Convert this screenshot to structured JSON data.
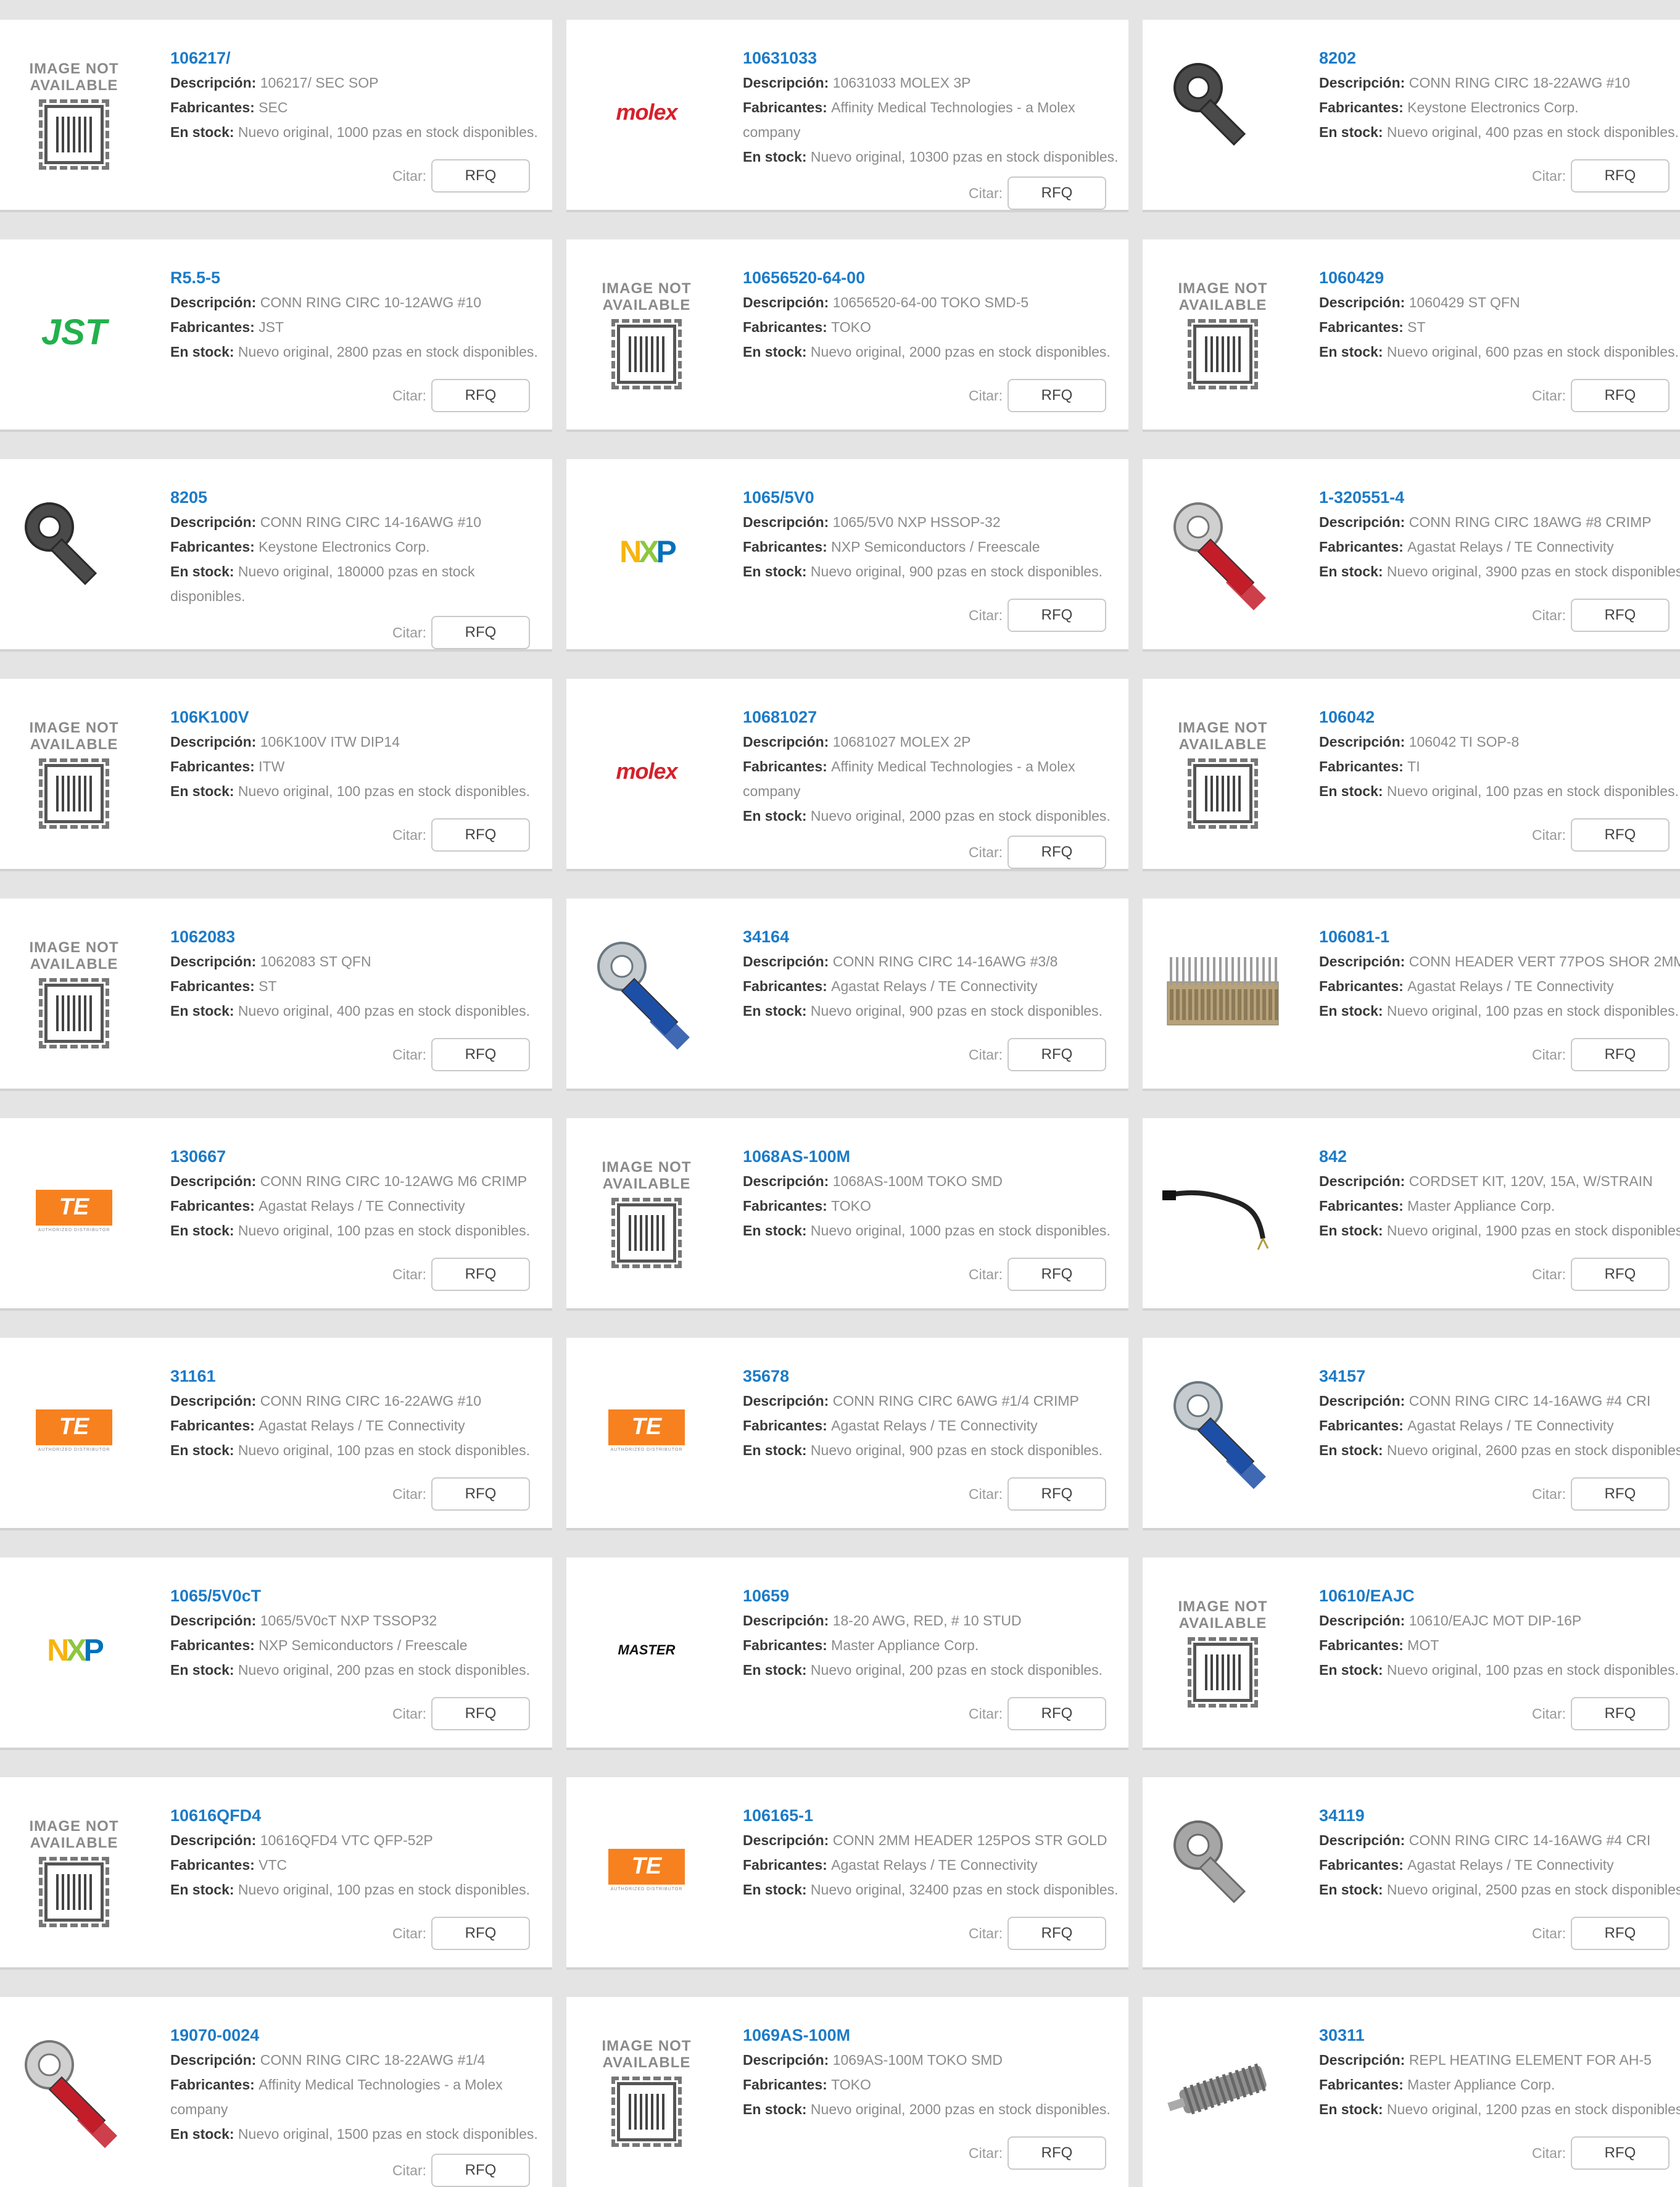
{
  "labels": {
    "desc": "Descripción:",
    "mfr": "Fabricantes:",
    "stock": "En stock:",
    "quote": "Citar:",
    "rfq": "RFQ"
  },
  "placeholder": {
    "line1": "IMAGE NOT",
    "line2": "AVAILABLE"
  },
  "logos": {
    "molex": "molex",
    "jst": "JST",
    "nxp": "NXP",
    "te": "TE",
    "te_sub": "AUTHORIZED DISTRIBUTOR",
    "master": "MASTER"
  },
  "colors": {
    "link": "#1c7bc8",
    "molex": "#d6202b",
    "jst": "#22b14c",
    "te": "#f7811f",
    "nxp_n": "#f6b40e",
    "nxp_x": "#8dc63f",
    "nxp_p": "#0071bb"
  },
  "products": [
    {
      "part": "106217/",
      "desc": "106217/ SEC SOP",
      "mfr": "SEC",
      "stock": "Nuevo original, 1000 pzas en stock disponibles.",
      "img": "na"
    },
    {
      "part": "10631033",
      "desc": "10631033 MOLEX 3P",
      "mfr": "Affinity Medical Technologies - a Molex company",
      "stock": "Nuevo original, 10300 pzas en stock disponibles.",
      "img": "molex"
    },
    {
      "part": "8202",
      "desc": "CONN RING CIRC 18-22AWG #10",
      "mfr": "Keystone Electronics Corp.",
      "stock": "Nuevo original, 400 pzas en stock disponibles.",
      "img": "ring-dark"
    },
    {
      "part": "R5.5-5",
      "desc": "CONN RING CIRC 10-12AWG #10",
      "mfr": "JST",
      "stock": "Nuevo original, 2800 pzas en stock disponibles.",
      "img": "jst"
    },
    {
      "part": "10656520-64-00",
      "desc": "10656520-64-00 TOKO SMD-5",
      "mfr": "TOKO",
      "stock": "Nuevo original, 2000 pzas en stock disponibles.",
      "img": "na"
    },
    {
      "part": "1060429",
      "desc": "1060429 ST QFN",
      "mfr": "ST",
      "stock": "Nuevo original, 600 pzas en stock disponibles.",
      "img": "na"
    },
    {
      "part": "8205",
      "desc": "CONN RING CIRC 14-16AWG #10",
      "mfr": "Keystone Electronics Corp.",
      "stock": "Nuevo original, 180000 pzas en stock disponibles.",
      "img": "ring-dark"
    },
    {
      "part": "1065/5V0",
      "desc": "1065/5V0 NXP HSSOP-32",
      "mfr": "NXP Semiconductors / Freescale",
      "stock": "Nuevo original, 900 pzas en stock disponibles.",
      "img": "nxp"
    },
    {
      "part": "1-320551-4",
      "desc": "CONN RING CIRC 18AWG #8 CRIMP",
      "mfr": "Agastat Relays / TE Connectivity",
      "stock": "Nuevo original, 3900 pzas en stock disponibles.",
      "img": "ring-red"
    },
    {
      "part": "106K100V",
      "desc": "106K100V ITW DIP14",
      "mfr": "ITW",
      "stock": "Nuevo original, 100 pzas en stock disponibles.",
      "img": "na"
    },
    {
      "part": "10681027",
      "desc": "10681027 MOLEX 2P",
      "mfr": "Affinity Medical Technologies - a Molex company",
      "stock": "Nuevo original, 2000 pzas en stock disponibles.",
      "img": "molex"
    },
    {
      "part": "106042",
      "desc": "106042  TI SOP-8",
      "mfr": "TI",
      "stock": "Nuevo original, 100 pzas en stock disponibles.",
      "img": "na"
    },
    {
      "part": "1062083",
      "desc": "1062083 ST QFN",
      "mfr": "ST",
      "stock": "Nuevo original, 400 pzas en stock disponibles.",
      "img": "na"
    },
    {
      "part": "34164",
      "desc": "CONN RING CIRC 14-16AWG #3/8",
      "mfr": "Agastat Relays / TE Connectivity",
      "stock": "Nuevo original, 900 pzas en stock disponibles.",
      "img": "ring-blue"
    },
    {
      "part": "106081-1",
      "desc": "CONN HEADER VERT 77POS SHOR 2MM",
      "mfr": "Agastat Relays / TE Connectivity",
      "stock": "Nuevo original, 100 pzas en stock disponibles.",
      "img": "header"
    },
    {
      "part": "130667",
      "desc": "CONN RING CIRC 10-12AWG M6 CRIMP",
      "mfr": "Agastat Relays / TE Connectivity",
      "stock": "Nuevo original, 100 pzas en stock disponibles.",
      "img": "te"
    },
    {
      "part": "1068AS-100M",
      "desc": "1068AS-100M TOKO SMD",
      "mfr": "TOKO",
      "stock": "Nuevo original, 1000 pzas en stock disponibles.",
      "img": "na"
    },
    {
      "part": "842",
      "desc": "CORDSET KIT, 120V, 15A, W/STRAIN",
      "mfr": "Master Appliance Corp.",
      "stock": "Nuevo original, 1900 pzas en stock disponibles.",
      "img": "cord"
    },
    {
      "part": "31161",
      "desc": "CONN RING CIRC 16-22AWG #10",
      "mfr": "Agastat Relays / TE Connectivity",
      "stock": "Nuevo original, 100 pzas en stock disponibles.",
      "img": "te"
    },
    {
      "part": "35678",
      "desc": "CONN RING CIRC 6AWG #1/4 CRIMP",
      "mfr": "Agastat Relays / TE Connectivity",
      "stock": "Nuevo original, 900 pzas en stock disponibles.",
      "img": "te"
    },
    {
      "part": "34157",
      "desc": "CONN RING CIRC 14-16AWG #4 CRI",
      "mfr": "Agastat Relays / TE Connectivity",
      "stock": "Nuevo original, 2600 pzas en stock disponibles.",
      "img": "ring-blue"
    },
    {
      "part": "1065/5V0cT",
      "desc": "1065/5V0cT NXP TSSOP32",
      "mfr": "NXP Semiconductors / Freescale",
      "stock": "Nuevo original, 200 pzas en stock disponibles.",
      "img": "nxp"
    },
    {
      "part": "10659",
      "desc": "18-20 AWG, RED, # 10 STUD",
      "mfr": "Master Appliance Corp.",
      "stock": "Nuevo original, 200 pzas en stock disponibles.",
      "img": "master"
    },
    {
      "part": "10610/EAJC",
      "desc": "10610/EAJC MOT DIP-16P",
      "mfr": "MOT",
      "stock": "Nuevo original, 100 pzas en stock disponibles.",
      "img": "na"
    },
    {
      "part": "10616QFD4",
      "desc": "10616QFD4 VTC QFP-52P",
      "mfr": "VTC",
      "stock": "Nuevo original, 100 pzas en stock disponibles.",
      "img": "na"
    },
    {
      "part": "106165-1",
      "desc": "CONN 2MM HEADER 125POS STR GOLD",
      "mfr": "Agastat Relays / TE Connectivity",
      "stock": "Nuevo original, 32400 pzas en stock disponibles.",
      "img": "te"
    },
    {
      "part": "34119",
      "desc": "CONN RING CIRC 14-16AWG #4 CRI",
      "mfr": "Agastat Relays / TE Connectivity",
      "stock": "Nuevo original, 2500 pzas en stock disponibles.",
      "img": "ring-metal"
    },
    {
      "part": "19070-0024",
      "desc": "CONN RING CIRC 18-22AWG #1/4",
      "mfr": "Affinity Medical Technologies - a Molex company",
      "stock": "Nuevo original, 1500 pzas en stock disponibles.",
      "img": "ring-red"
    },
    {
      "part": "1069AS-100M",
      "desc": "1069AS-100M TOKO SMD",
      "mfr": "TOKO",
      "stock": "Nuevo original, 2000 pzas en stock disponibles.",
      "img": "na"
    },
    {
      "part": "30311",
      "desc": "REPL HEATING ELEMENT FOR AH-5",
      "mfr": "Master Appliance Corp.",
      "stock": "Nuevo original, 1200 pzas en stock disponibles.",
      "img": "heater"
    }
  ]
}
